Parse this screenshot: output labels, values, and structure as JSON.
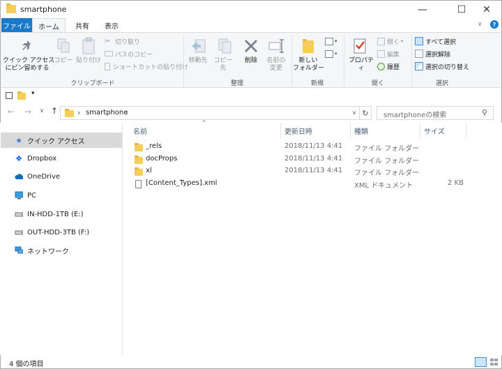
{
  "window": {
    "title": "smartphone",
    "minimize_glyph": "—",
    "maximize_glyph": "☐",
    "close_glyph": "✕"
  },
  "ribbon_tabs": [
    "ファイル",
    "ホーム",
    "共有",
    "表示"
  ],
  "ribbon": {
    "pin_quick_access": "クイック アクセス\nにピン留めする",
    "copy": "コピー",
    "paste": "貼り付け",
    "cut": "切り取り",
    "copy_path": "パスのコピー",
    "paste_shortcut": "ショートカットの貼り付け",
    "group_clipboard": "クリップボード",
    "move_to": "移動先",
    "copy_to": "コピー先",
    "delete": "削除",
    "rename": "名前の\n変更",
    "group_organize": "整理",
    "new_folder": "新しい\nフォルダー",
    "group_new": "新規",
    "properties": "プロパティ",
    "open": "開く",
    "edit": "編集",
    "history": "履歴",
    "group_open": "開く",
    "select_all": "すべて選択",
    "select_none": "選択解除",
    "invert_selection": "選択の切り替え",
    "group_select": "選択"
  },
  "address": {
    "path": "smartphone",
    "separator": "›"
  },
  "search": {
    "placeholder": "smartphoneの検索"
  },
  "nav": [
    {
      "label": "クイック アクセス",
      "icon": "star-icon"
    },
    {
      "label": "Dropbox",
      "icon": "dropbox-icon"
    },
    {
      "label": "OneDrive",
      "icon": "cloud-icon"
    },
    {
      "label": "PC",
      "icon": "monitor-icon"
    },
    {
      "label": "IN-HDD-1TB (E:)",
      "icon": "drive-icon"
    },
    {
      "label": "OUT-HDD-3TB (F:)",
      "icon": "drive-icon"
    },
    {
      "label": "ネットワーク",
      "icon": "network-icon"
    }
  ],
  "columns": {
    "name": "名前",
    "modified": "更新日時",
    "type": "種類",
    "size": "サイズ"
  },
  "files": [
    {
      "name": "_rels",
      "modified": "2018/11/13 4:41",
      "type": "ファイル フォルダー",
      "size": "",
      "icon": "folder-icon"
    },
    {
      "name": "docProps",
      "modified": "2018/11/13 4:41",
      "type": "ファイル フォルダー",
      "size": "",
      "icon": "folder-icon"
    },
    {
      "name": "xl",
      "modified": "2018/11/13 4:41",
      "type": "ファイル フォルダー",
      "size": "",
      "icon": "folder-icon"
    },
    {
      "name": "[Content_Types].xml",
      "modified": "",
      "type": "XML ドキュメント",
      "size": "2 KB",
      "icon": "xml-file-icon"
    }
  ],
  "status": {
    "item_count": "4 個の項目"
  }
}
